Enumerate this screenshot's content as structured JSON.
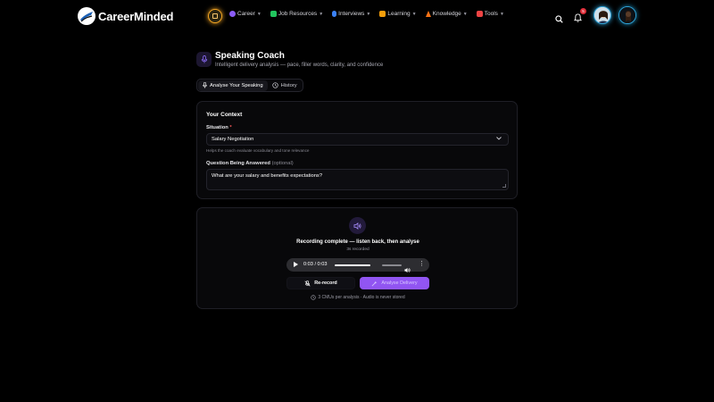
{
  "brand": {
    "name": "CareerMinded"
  },
  "nav": {
    "items": [
      {
        "label": "Career",
        "color": "#8b5cf6"
      },
      {
        "label": "Job Resources",
        "color": "#22c55e"
      },
      {
        "label": "Interviews",
        "color": "#3b82f6"
      },
      {
        "label": "Learning",
        "color": "#f59e0b"
      },
      {
        "label": "Knowledge",
        "color": "#f97316"
      },
      {
        "label": "Tools",
        "color": "#ef4444"
      }
    ],
    "notification_count": "5"
  },
  "header": {
    "title": "Speaking Coach",
    "subtitle": "Intelligent delivery analysis — pace, filler words, clarity, and confidence"
  },
  "tabs": [
    {
      "label": "Analyse Your Speaking",
      "active": true
    },
    {
      "label": "History",
      "active": false
    }
  ],
  "context": {
    "heading": "Your Context",
    "situation_label": "Situation",
    "required_mark": "*",
    "situation_value": "Salary Negotiation",
    "situation_hint": "Helps the coach evaluate vocabulary and tone relevance",
    "question_label": "Question Being Answered",
    "question_optional": "(optional)",
    "question_value": "What are your salary and benefits expectations?"
  },
  "recording": {
    "status": "Recording complete — listen back, then analyse",
    "duration": "3s recorded",
    "player_time": "0:03 / 0:03",
    "rerecord_label": "Re-record",
    "analyse_label": "Analyse Delivery",
    "footer_note": "3 CMUs per analysis · Audio is never stored"
  },
  "colors": {
    "accent": "#9155f2",
    "badge": "#f5a623",
    "notification": "#e02e3a"
  }
}
